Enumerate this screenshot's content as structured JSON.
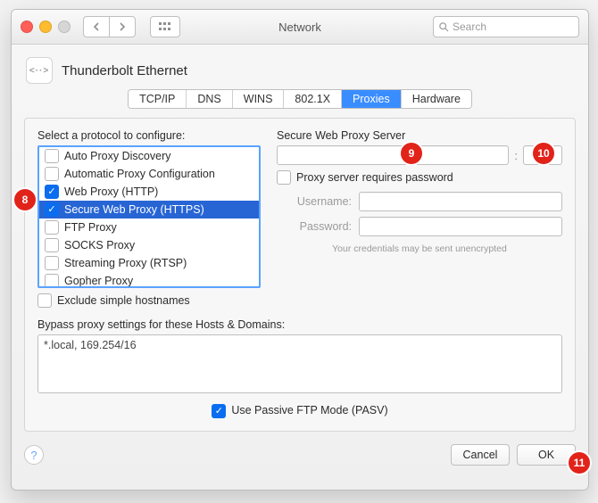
{
  "window": {
    "title": "Network"
  },
  "search": {
    "placeholder": "Search"
  },
  "interface": {
    "name": "Thunderbolt Ethernet",
    "icon_glyph": "<··>"
  },
  "badges": {
    "b8": "8",
    "b9": "9",
    "b10": "10",
    "b11": "11"
  },
  "tabs": [
    {
      "label": "TCP/IP",
      "active": false
    },
    {
      "label": "DNS",
      "active": false
    },
    {
      "label": "WINS",
      "active": false
    },
    {
      "label": "802.1X",
      "active": false
    },
    {
      "label": "Proxies",
      "active": true
    },
    {
      "label": "Hardware",
      "active": false
    }
  ],
  "proxies": {
    "select_label": "Select a protocol to configure:",
    "items": [
      {
        "label": "Auto Proxy Discovery",
        "checked": false,
        "selected": false
      },
      {
        "label": "Automatic Proxy Configuration",
        "checked": false,
        "selected": false
      },
      {
        "label": "Web Proxy (HTTP)",
        "checked": true,
        "selected": false
      },
      {
        "label": "Secure Web Proxy (HTTPS)",
        "checked": true,
        "selected": true
      },
      {
        "label": "FTP Proxy",
        "checked": false,
        "selected": false
      },
      {
        "label": "SOCKS Proxy",
        "checked": false,
        "selected": false
      },
      {
        "label": "Streaming Proxy (RTSP)",
        "checked": false,
        "selected": false
      },
      {
        "label": "Gopher Proxy",
        "checked": false,
        "selected": false
      }
    ],
    "exclude_simple_label": "Exclude simple hostnames",
    "exclude_simple_checked": false,
    "server_section_label": "Secure Web Proxy Server",
    "host_value": "",
    "port_value": "",
    "requires_password_label": "Proxy server requires password",
    "requires_password_checked": false,
    "username_label": "Username:",
    "username_value": "",
    "password_label": "Password:",
    "password_value": "",
    "credentials_hint": "Your credentials may be sent unencrypted",
    "bypass_label": "Bypass proxy settings for these Hosts & Domains:",
    "bypass_value": "*.local, 169.254/16",
    "pasv_label": "Use Passive FTP Mode (PASV)",
    "pasv_checked": true
  },
  "footer": {
    "cancel": "Cancel",
    "ok": "OK"
  }
}
